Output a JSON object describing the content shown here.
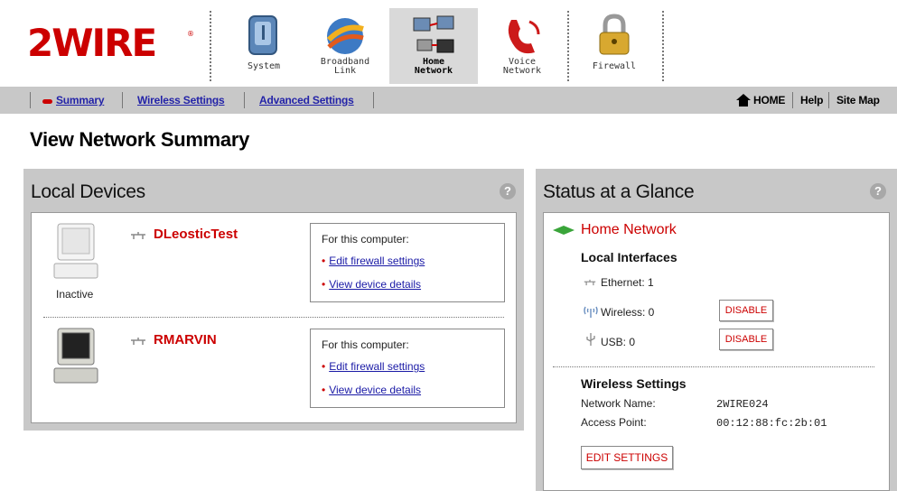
{
  "brand": {
    "logo_text": "2WIRE"
  },
  "nav": {
    "items": [
      {
        "label": "System",
        "icon": "system-icon"
      },
      {
        "label": "Broadband\nLink",
        "icon": "broadband-globe-icon"
      },
      {
        "label": "Home\nNetwork",
        "icon": "home-network-icon",
        "active": true
      },
      {
        "label": "Voice\nNetwork",
        "icon": "phone-icon"
      },
      {
        "label": "Firewall",
        "icon": "padlock-icon"
      }
    ]
  },
  "subnav": {
    "links": [
      "Summary",
      "Wireless Settings",
      "Advanced Settings"
    ],
    "right": {
      "home": "HOME",
      "help": "Help",
      "sitemap": "Site Map"
    }
  },
  "page": {
    "title": "View Network Summary"
  },
  "local_devices": {
    "title": "Local Devices",
    "devices": [
      {
        "name": "DLeosticTest",
        "state": "Inactive",
        "box_header": "For this computer:",
        "links": [
          "Edit firewall settings",
          "View device details"
        ]
      },
      {
        "name": "RMARVIN",
        "state": "",
        "box_header": "For this computer:",
        "links": [
          "Edit firewall settings",
          "View device details"
        ]
      }
    ]
  },
  "status": {
    "title": "Status at a Glance",
    "home_network": "Home Network",
    "local_interfaces": "Local Interfaces",
    "ethernet": "Ethernet: 1",
    "wireless": "Wireless: 0",
    "usb": "USB: 0",
    "disable_label": "DISABLE",
    "wireless_settings": "Wireless Settings",
    "network_name_label": "Network Name:",
    "network_name": "2WIRE024",
    "access_point_label": "Access Point:",
    "access_point": "00:12:88:fc:2b:01",
    "edit_settings": "EDIT SETTINGS"
  },
  "colors": {
    "accent_red": "#cc0000",
    "link_blue": "#2323a8",
    "panel_gray": "#c8c8c8"
  }
}
